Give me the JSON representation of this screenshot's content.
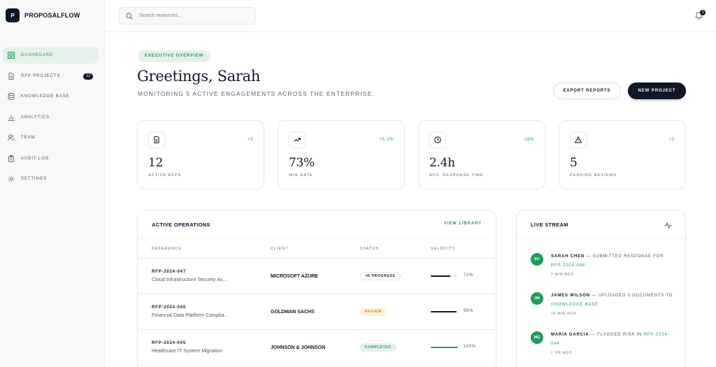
{
  "brand": {
    "logo_letter": "P",
    "name": "PROPOSALFLOW"
  },
  "sidebar": {
    "items": [
      {
        "label": "DASHBOARD",
        "icon": "grid-icon",
        "active": true
      },
      {
        "label": "RFP PROJECTS",
        "icon": "document-icon",
        "badge": "12"
      },
      {
        "label": "KNOWLEDGE BASE",
        "icon": "database-icon"
      },
      {
        "label": "ANALYTICS",
        "icon": "bar-chart-icon"
      },
      {
        "label": "TEAM",
        "icon": "users-icon"
      },
      {
        "label": "AUDIT LOG",
        "icon": "clipboard-icon"
      },
      {
        "label": "SETTINGS",
        "icon": "gear-icon"
      }
    ]
  },
  "topbar": {
    "search_placeholder": "Search resources...",
    "notifications_count": "3"
  },
  "hero": {
    "pill": "EXECUTIVE OVERVIEW",
    "greeting": "Greetings, Sarah",
    "subtitle": "MONITORING 5 ACTIVE ENGAGEMENTS ACROSS THE ENTERPRISE.",
    "export_label": "EXPORT REPORTS",
    "new_label": "NEW PROJECT"
  },
  "stats": [
    {
      "icon": "document-icon",
      "delta": "+3",
      "delta_color": "#1f9d5c",
      "value": "12",
      "label": "ACTIVE RFPS"
    },
    {
      "icon": "trend-up-icon",
      "delta": "+5.2%",
      "delta_color": "#1f9d5c",
      "value": "73%",
      "label": "WIN RATE"
    },
    {
      "icon": "clock-icon",
      "delta": "-18%",
      "delta_color": "#1f9d5c",
      "value": "2.4h",
      "label": "AVG. RESPONSE TIME"
    },
    {
      "icon": "warning-icon",
      "delta": "+2",
      "delta_color": "#d9342b",
      "value": "5",
      "label": "PENDING REVIEWS"
    }
  ],
  "operations": {
    "title": "ACTIVE OPERATIONS",
    "link": "VIEW LIBRARY",
    "columns": [
      "REFERENCE",
      "CLIENT",
      "STATUS",
      "VELOCITY"
    ],
    "rows": [
      {
        "ref": "RFP-2024-047",
        "desc": "Cloud Infrastructure Security As...",
        "client": "MICROSOFT AZURE",
        "status": "IN PROGRESS",
        "status_kind": "progress",
        "velocity": 72,
        "velocity_label": "72%",
        "bar_color": "#0f1729"
      },
      {
        "ref": "RFP-2024-046",
        "desc": "Financial Data Platform Complia...",
        "client": "GOLDMAN SACHS",
        "status": "REVIEW",
        "status_kind": "review",
        "velocity": 95,
        "velocity_label": "95%",
        "bar_color": "#0f1729"
      },
      {
        "ref": "RFP-2024-045",
        "desc": "Healthcare IT System Migration",
        "client": "JOHNSON & JOHNSON",
        "status": "COMPLETED",
        "status_kind": "completed",
        "velocity": 100,
        "velocity_label": "100%",
        "bar_color": "#1f9d5c"
      }
    ]
  },
  "stream": {
    "title": "LIVE STREAM",
    "activities": [
      {
        "initials": "SC",
        "name": "SARAH CHEN",
        "action": "SUBMITTED RESPONSE FOR",
        "target": "RFP-2024-046",
        "time": "2 MIN AGO"
      },
      {
        "initials": "JW",
        "name": "JAMES WILSON",
        "action": "UPLOADED 3 DOCUMENTS TO",
        "target": "KNOWLEDGE BASE",
        "time": "15 MIN AGO"
      },
      {
        "initials": "MG",
        "name": "MARIA GARCIA",
        "action": "FLAGGED RISK IN",
        "target": "RFP-2024-044",
        "time": "1 HR AGO"
      }
    ]
  },
  "colors": {
    "accent": "#1f9d5c",
    "dark": "#0f1729",
    "warn": "#c68a12",
    "danger": "#d9342b"
  }
}
